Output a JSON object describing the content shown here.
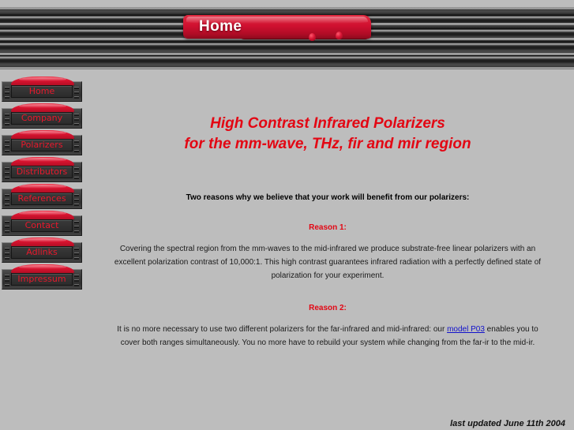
{
  "page": {
    "background_color": "#bdbdbd",
    "accent_color": "#e30613",
    "link_color": "#1111cc"
  },
  "header": {
    "title": "Home",
    "drops": [
      "blood-drop-1",
      "blood-drop-2"
    ]
  },
  "sidebar": {
    "items": [
      {
        "label": "Home"
      },
      {
        "label": "Company"
      },
      {
        "label": "Polarizers"
      },
      {
        "label": "Distributors"
      },
      {
        "label": "References"
      },
      {
        "label": "Contact"
      },
      {
        "label": "Adlinks"
      },
      {
        "label": "Impressum"
      }
    ]
  },
  "main": {
    "heading_line1": "High Contrast Infrared Polarizers",
    "heading_line2": "for the mm-wave, THz, fir and mir region",
    "intro": "Two reasons why we believe that your work will benefit from our polarizers:",
    "reason1_heading": "Reason 1:",
    "reason1_body": "Covering the spectral region from the mm-waves to the mid-infrared we produce substrate-free linear polarizers with an excellent polarization contrast of 10,000:1. This high contrast guarantees infrared radiation with a perfectly defined state of polarization for your experiment.",
    "reason2_heading": "Reason 2:",
    "reason2_body_before": "It is no more necessary to use two different polarizers for the far-infrared and mid-infrared: our ",
    "reason2_link": "model P03",
    "reason2_body_after": " enables you to cover both ranges simultaneously. You no more have to rebuild your system while changing from the far-ir to the mid-ir."
  },
  "footer": {
    "last_updated": "last updated June 11th 2004"
  }
}
